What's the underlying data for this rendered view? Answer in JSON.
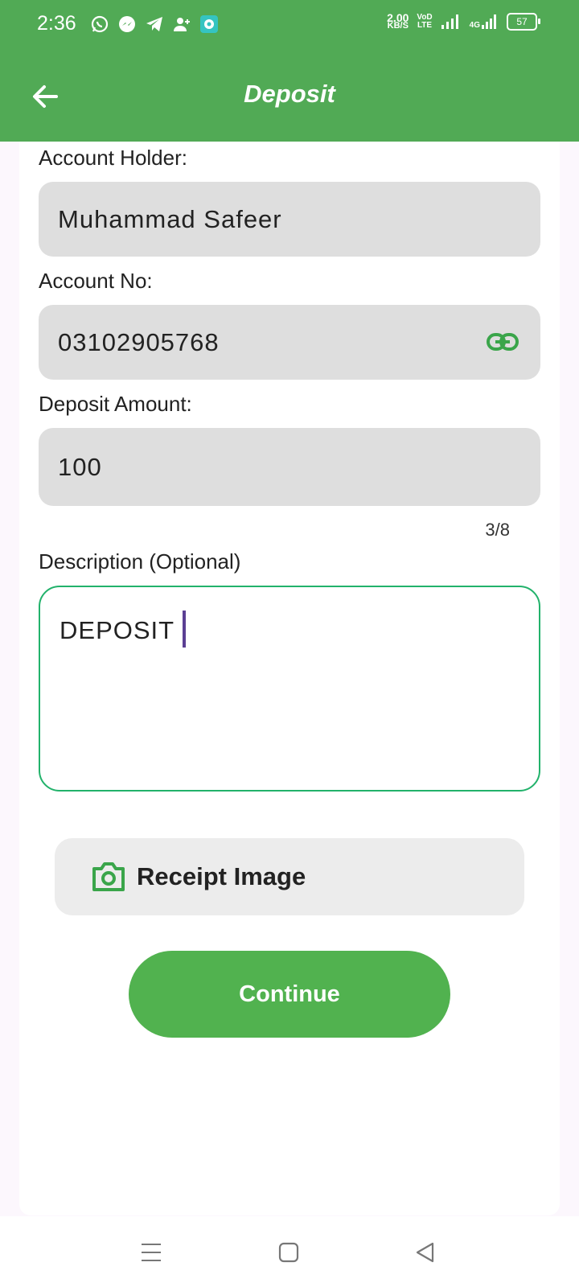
{
  "status_bar": {
    "time": "2:36",
    "net_speed_value": "2.00",
    "net_speed_unit": "KB/S",
    "volte_line1": "VoD",
    "volte_line2": "LTE",
    "signal_2_label": "4G",
    "battery": "57"
  },
  "app_bar": {
    "title": "Deposit",
    "color": "#51aa55"
  },
  "form": {
    "account_holder_label": "Account Holder:",
    "account_holder_value": "Muhammad Safeer",
    "account_no_label": "Account No:",
    "account_no_value": "03102905768",
    "deposit_amount_label": "Deposit Amount:",
    "deposit_amount_value": "100",
    "deposit_amount_counter": "3/8",
    "description_label": "Description (Optional)",
    "description_value": "DEPOSIT"
  },
  "receipt_button": {
    "label": "Receipt Image",
    "icon": "camera-icon"
  },
  "continue_button": {
    "label": "Continue",
    "color": "#51b24f"
  },
  "nav_bar": {
    "buttons": [
      "menu-icon",
      "home-icon",
      "back-triangle-icon"
    ]
  }
}
